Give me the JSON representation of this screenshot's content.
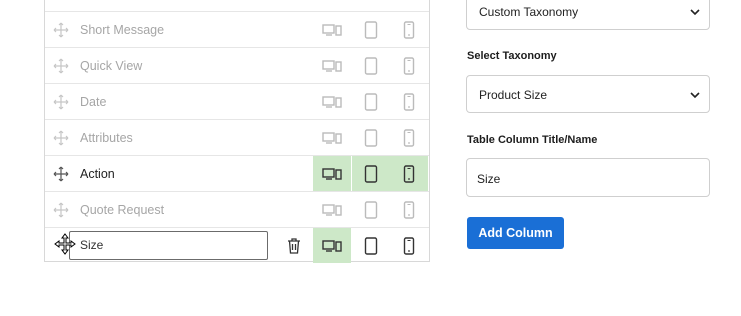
{
  "table": {
    "rows": [
      {
        "label": "Short Message",
        "faded": true
      },
      {
        "label": "Quick View",
        "faded": true
      },
      {
        "label": "Date",
        "faded": true
      },
      {
        "label": "Attributes",
        "faded": true
      },
      {
        "label": "Action",
        "faded": false
      },
      {
        "label": "Quote Request",
        "faded": true
      }
    ],
    "new_row": {
      "value": "Size"
    }
  },
  "sidebar": {
    "type_select_value": "Custom Taxonomy",
    "taxonomy_label": "Select Taxonomy",
    "taxonomy_select_value": "Product Size",
    "title_label": "Table Column Title/Name",
    "title_input_value": "Size",
    "add_button_label": "Add Column"
  },
  "colors": {
    "accent": "#1a6fd6",
    "active_device_bg": "#cde8c8"
  },
  "icons": [
    "drag-handle-icon",
    "desktop-icon",
    "tablet-icon",
    "mobile-icon",
    "trash-icon",
    "chevron-down-icon",
    "move-cursor-icon"
  ]
}
